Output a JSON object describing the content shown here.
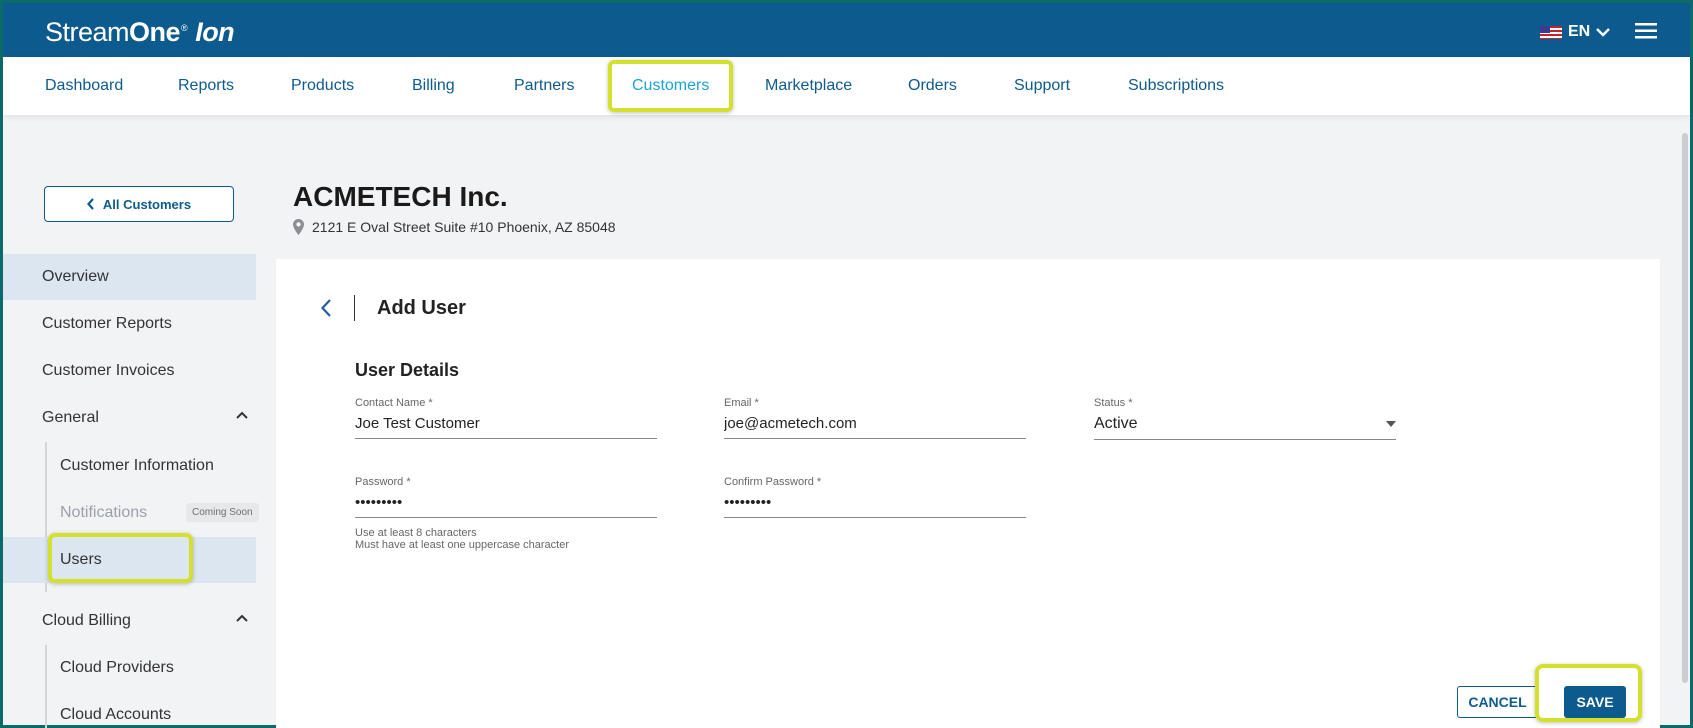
{
  "header": {
    "logo_stream": "Stream",
    "logo_one": "One",
    "logo_reg": "®",
    "logo_ion": "Ion",
    "language": "EN",
    "language_flag_icon": "us-flag-icon",
    "menu_icon": "hamburger-menu-icon"
  },
  "nav": {
    "items": [
      {
        "label": "Dashboard"
      },
      {
        "label": "Reports"
      },
      {
        "label": "Products"
      },
      {
        "label": "Billing"
      },
      {
        "label": "Partners"
      },
      {
        "label": "Customers",
        "active": true
      },
      {
        "label": "Marketplace"
      },
      {
        "label": "Orders"
      },
      {
        "label": "Support"
      },
      {
        "label": "Subscriptions"
      }
    ]
  },
  "sidebar": {
    "back_label": "All Customers",
    "items": [
      {
        "label": "Overview",
        "selected": true
      },
      {
        "label": "Customer Reports"
      },
      {
        "label": "Customer Invoices"
      },
      {
        "label": "General",
        "expanded": true
      },
      {
        "label": "Customer Information"
      },
      {
        "label": "Notifications",
        "disabled": true,
        "badge": "Coming Soon"
      },
      {
        "label": "Users",
        "selected": true
      },
      {
        "label": "Cloud Billing",
        "expanded": true
      },
      {
        "label": "Cloud Providers"
      },
      {
        "label": "Cloud Accounts"
      }
    ]
  },
  "customer": {
    "name": "ACMETECH Inc.",
    "address": "2121 E Oval Street Suite #10 Phoenix, AZ 85048"
  },
  "form": {
    "title": "Add User",
    "section": "User Details",
    "contact_name_label": "Contact Name *",
    "contact_name_value": "Joe Test Customer",
    "email_label": "Email *",
    "email_value": "joe@acmetech.com",
    "status_label": "Status *",
    "status_value": "Active",
    "password_label": "Password *",
    "password_value": "•••••••••",
    "confirm_password_label": "Confirm Password *",
    "confirm_password_value": "•••••••••",
    "hint_line1": "Use at least 8 characters",
    "hint_line2": "Must have at least one uppercase character",
    "cancel_label": "CANCEL",
    "save_label": "SAVE"
  },
  "colors": {
    "brand": "#0d5a8e",
    "active_nav": "#1aa3d9",
    "highlight": "#d4e02c",
    "selected_bg": "#dce6f1"
  }
}
